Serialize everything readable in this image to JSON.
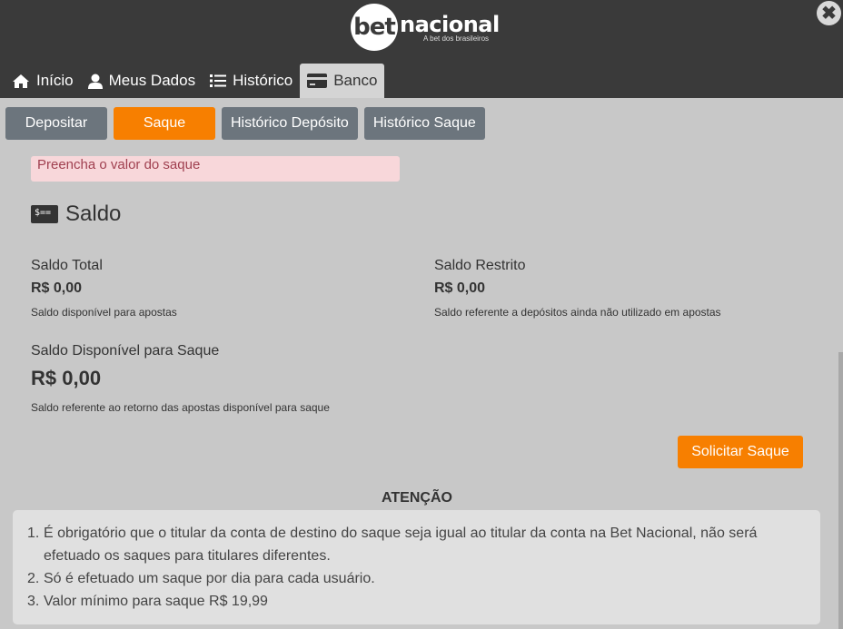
{
  "brand": {
    "logo_bet": "bet",
    "logo_name": "nacional",
    "tagline": "A bet dos brasileiros"
  },
  "close": {
    "symbol": "✖"
  },
  "tabs": [
    {
      "label": "Início",
      "icon": "home-icon"
    },
    {
      "label": "Meus Dados",
      "icon": "user-icon"
    },
    {
      "label": "Histórico",
      "icon": "list-icon"
    },
    {
      "label": "Banco",
      "icon": "credit-card-icon",
      "active": true
    }
  ],
  "subtabs": [
    {
      "label": "Depositar"
    },
    {
      "label": "Saque",
      "active": true
    },
    {
      "label": "Histórico Depósito"
    },
    {
      "label": "Histórico Saque"
    }
  ],
  "alert": {
    "text": "Preencha o valor do saque"
  },
  "saldo": {
    "title": "Saldo",
    "icon_text": "$==",
    "total_label": "Saldo Total",
    "total_value": "R$ 0,00",
    "total_note": "Saldo disponível para apostas",
    "restrito_label": "Saldo Restrito",
    "restrito_value": "R$ 0,00",
    "restrito_note": "Saldo referente a depósitos ainda não utilizado em apostas",
    "disponivel_label": "Saldo Disponível para Saque",
    "disponivel_value": "R$ 0,00",
    "disponivel_note": "Saldo referente ao retorno das apostas disponível para saque"
  },
  "actions": {
    "solicitar_label": "Solicitar Saque"
  },
  "attention": {
    "title": "ATENÇÃO",
    "items": [
      {
        "num": "1.",
        "text": "É obrigatório que o titular da conta de destino do saque seja igual ao titular da conta na Bet Nacional, não será efetuado os saques para titulares diferentes."
      },
      {
        "num": "2.",
        "text": "Só é efetuado um saque por dia para cada usuário."
      },
      {
        "num": "3.",
        "text": "Valor mínimo para saque R$ 19,99"
      }
    ]
  },
  "colors": {
    "accent": "#f77f00",
    "header": "#3a3a3a",
    "subtab": "#6c757d",
    "alert_bg": "#f8d7da"
  }
}
